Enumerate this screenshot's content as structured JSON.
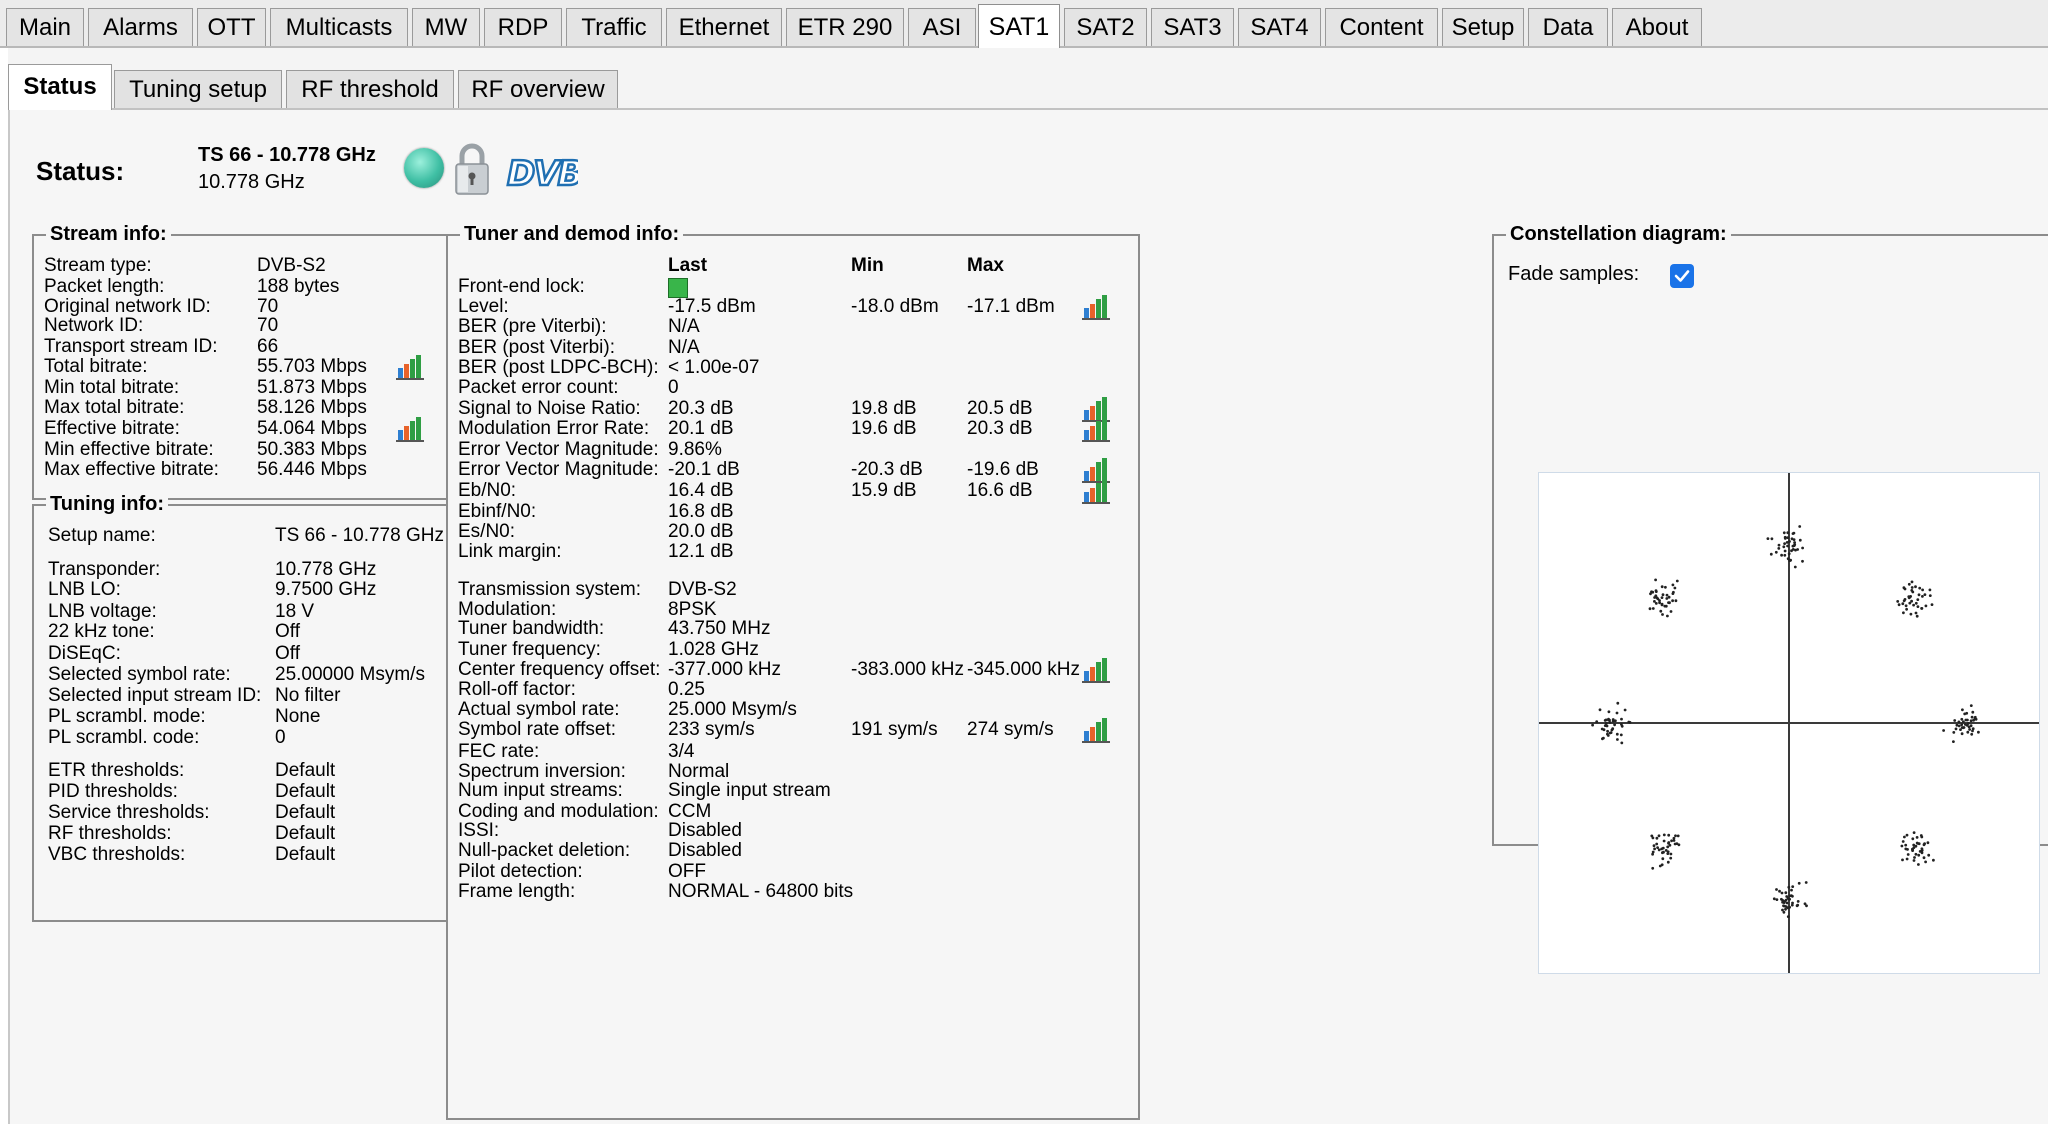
{
  "top_tabs": [
    {
      "label": "Main"
    },
    {
      "label": "Alarms"
    },
    {
      "label": "OTT"
    },
    {
      "label": "Multicasts"
    },
    {
      "label": "MW"
    },
    {
      "label": "RDP"
    },
    {
      "label": "Traffic"
    },
    {
      "label": "Ethernet"
    },
    {
      "label": "ETR 290"
    },
    {
      "label": "ASI"
    },
    {
      "label": "SAT1"
    },
    {
      "label": "SAT2"
    },
    {
      "label": "SAT3"
    },
    {
      "label": "SAT4"
    },
    {
      "label": "Content"
    },
    {
      "label": "Setup"
    },
    {
      "label": "Data"
    },
    {
      "label": "About"
    }
  ],
  "active_top_tab": "SAT1",
  "sub_tabs": [
    {
      "label": "Status"
    },
    {
      "label": "Tuning setup"
    },
    {
      "label": "RF threshold"
    },
    {
      "label": "RF overview"
    }
  ],
  "status": {
    "label": "Status:",
    "name": "TS 66 - 10.778 GHz",
    "freq": "10.778 GHz",
    "icons": [
      "status-led-icon",
      "lock-icon",
      "dvb-logo-icon"
    ],
    "logo_text": "DVB"
  },
  "stream_info": {
    "title": "Stream info:",
    "rows": [
      {
        "label": "Stream type:",
        "value": "DVB-S2"
      },
      {
        "label": "Packet length:",
        "value": "188 bytes"
      },
      {
        "label": "Original network ID:",
        "value": "70"
      },
      {
        "label": "Network ID:",
        "value": "70"
      },
      {
        "label": "Transport stream ID:",
        "value": "66"
      },
      {
        "label": "Total bitrate:",
        "value": "55.703 Mbps"
      },
      {
        "label": "Min total bitrate:",
        "value": "51.873 Mbps"
      },
      {
        "label": "Max total bitrate:",
        "value": "58.126 Mbps"
      },
      {
        "label": "Effective bitrate:",
        "value": "54.064 Mbps"
      },
      {
        "label": "Min effective bitrate:",
        "value": "50.383 Mbps"
      },
      {
        "label": "Max effective bitrate:",
        "value": "56.446 Mbps"
      }
    ]
  },
  "tuning_info": {
    "title": "Tuning info:",
    "rows": [
      {
        "label": "Setup name:",
        "value": "TS 66 - 10.778 GHz"
      },
      {
        "label": "Transponder:",
        "value": "10.778 GHz"
      },
      {
        "label": "LNB LO:",
        "value": "9.7500 GHz"
      },
      {
        "label": "LNB voltage:",
        "value": "18 V"
      },
      {
        "label": "22 kHz tone:",
        "value": "Off"
      },
      {
        "label": "DiSEqC:",
        "value": "Off"
      },
      {
        "label": "Selected symbol rate:",
        "value": "25.00000 Msym/s"
      },
      {
        "label": "Selected input stream ID:",
        "value": "No filter"
      },
      {
        "label": "PL scrambl. mode:",
        "value": "None"
      },
      {
        "label": "PL scrambl. code:",
        "value": "0"
      },
      {
        "label": "ETR thresholds:",
        "value": "Default"
      },
      {
        "label": "PID thresholds:",
        "value": "Default"
      },
      {
        "label": "Service thresholds:",
        "value": "Default"
      },
      {
        "label": "RF thresholds:",
        "value": "Default"
      },
      {
        "label": "VBC thresholds:",
        "value": "Default"
      }
    ]
  },
  "tuner_info": {
    "title": "Tuner and demod info:",
    "headers": {
      "last": "Last",
      "min": "Min",
      "max": "Max"
    },
    "rows": [
      {
        "label": "Front-end lock:",
        "last": "",
        "min": "",
        "max": ""
      },
      {
        "label": "Level:",
        "last": "-17.5 dBm",
        "min": "-18.0 dBm",
        "max": "-17.1 dBm"
      },
      {
        "label": "BER (pre Viterbi):",
        "last": "N/A",
        "min": "",
        "max": ""
      },
      {
        "label": "BER (post Viterbi):",
        "last": "N/A",
        "min": "",
        "max": ""
      },
      {
        "label": "BER (post LDPC-BCH):",
        "last": "< 1.00e-07",
        "min": "",
        "max": ""
      },
      {
        "label": "Packet error count:",
        "last": "0",
        "min": "",
        "max": ""
      },
      {
        "label": "Signal to Noise Ratio:",
        "last": "20.3 dB",
        "min": "19.8 dB",
        "max": "20.5 dB"
      },
      {
        "label": "Modulation Error Rate:",
        "last": "20.1 dB",
        "min": "19.6 dB",
        "max": "20.3 dB"
      },
      {
        "label": "Error Vector Magnitude:",
        "last": "9.86%",
        "min": "",
        "max": ""
      },
      {
        "label": "Error Vector Magnitude:",
        "last": "-20.1 dB",
        "min": "-20.3 dB",
        "max": "-19.6 dB"
      },
      {
        "label": "Eb/N0:",
        "last": "16.4 dB",
        "min": "15.9 dB",
        "max": "16.6 dB"
      },
      {
        "label": "Ebinf/N0:",
        "last": "16.8 dB",
        "min": "",
        "max": ""
      },
      {
        "label": "Es/N0:",
        "last": "20.0 dB",
        "min": "",
        "max": ""
      },
      {
        "label": "Link margin:",
        "last": "12.1 dB",
        "min": "",
        "max": ""
      },
      {
        "label": "Transmission system:",
        "last": "DVB-S2",
        "min": "",
        "max": ""
      },
      {
        "label": "Modulation:",
        "last": "8PSK",
        "min": "",
        "max": ""
      },
      {
        "label": "Tuner bandwidth:",
        "last": "43.750 MHz",
        "min": "",
        "max": ""
      },
      {
        "label": "Tuner frequency:",
        "last": "1.028 GHz",
        "min": "",
        "max": ""
      },
      {
        "label": "Center frequency offset:",
        "last": "-377.000 kHz",
        "min": "-383.000 kHz",
        "max": "-345.000 kHz"
      },
      {
        "label": "Roll-off factor:",
        "last": "0.25",
        "min": "",
        "max": ""
      },
      {
        "label": "Actual symbol rate:",
        "last": "25.000 Msym/s",
        "min": "",
        "max": ""
      },
      {
        "label": "Symbol rate offset:",
        "last": "233 sym/s",
        "min": "191 sym/s",
        "max": "274 sym/s"
      },
      {
        "label": "FEC rate:",
        "last": "3/4",
        "min": "",
        "max": ""
      },
      {
        "label": "Spectrum inversion:",
        "last": "Normal",
        "min": "",
        "max": ""
      },
      {
        "label": "Num input streams:",
        "last": "Single input stream",
        "min": "",
        "max": ""
      },
      {
        "label": "Coding and modulation:",
        "last": "CCM",
        "min": "",
        "max": ""
      },
      {
        "label": "ISSI:",
        "last": "Disabled",
        "min": "",
        "max": ""
      },
      {
        "label": "Null-packet deletion:",
        "last": "Disabled",
        "min": "",
        "max": ""
      },
      {
        "label": "Pilot detection:",
        "last": "OFF",
        "min": "",
        "max": ""
      },
      {
        "label": "Frame length:",
        "last": "NORMAL - 64800 bits",
        "min": "",
        "max": ""
      }
    ]
  },
  "constellation": {
    "title": "Constellation diagram:",
    "fade_label": "Fade samples:",
    "fade_checked": true,
    "modulation": "8PSK"
  },
  "colors": {
    "accent": "#1a73e8",
    "lock_green": "#39b54a",
    "led": "#3fbfa4",
    "dvb_blue": "#1f6fb2"
  }
}
